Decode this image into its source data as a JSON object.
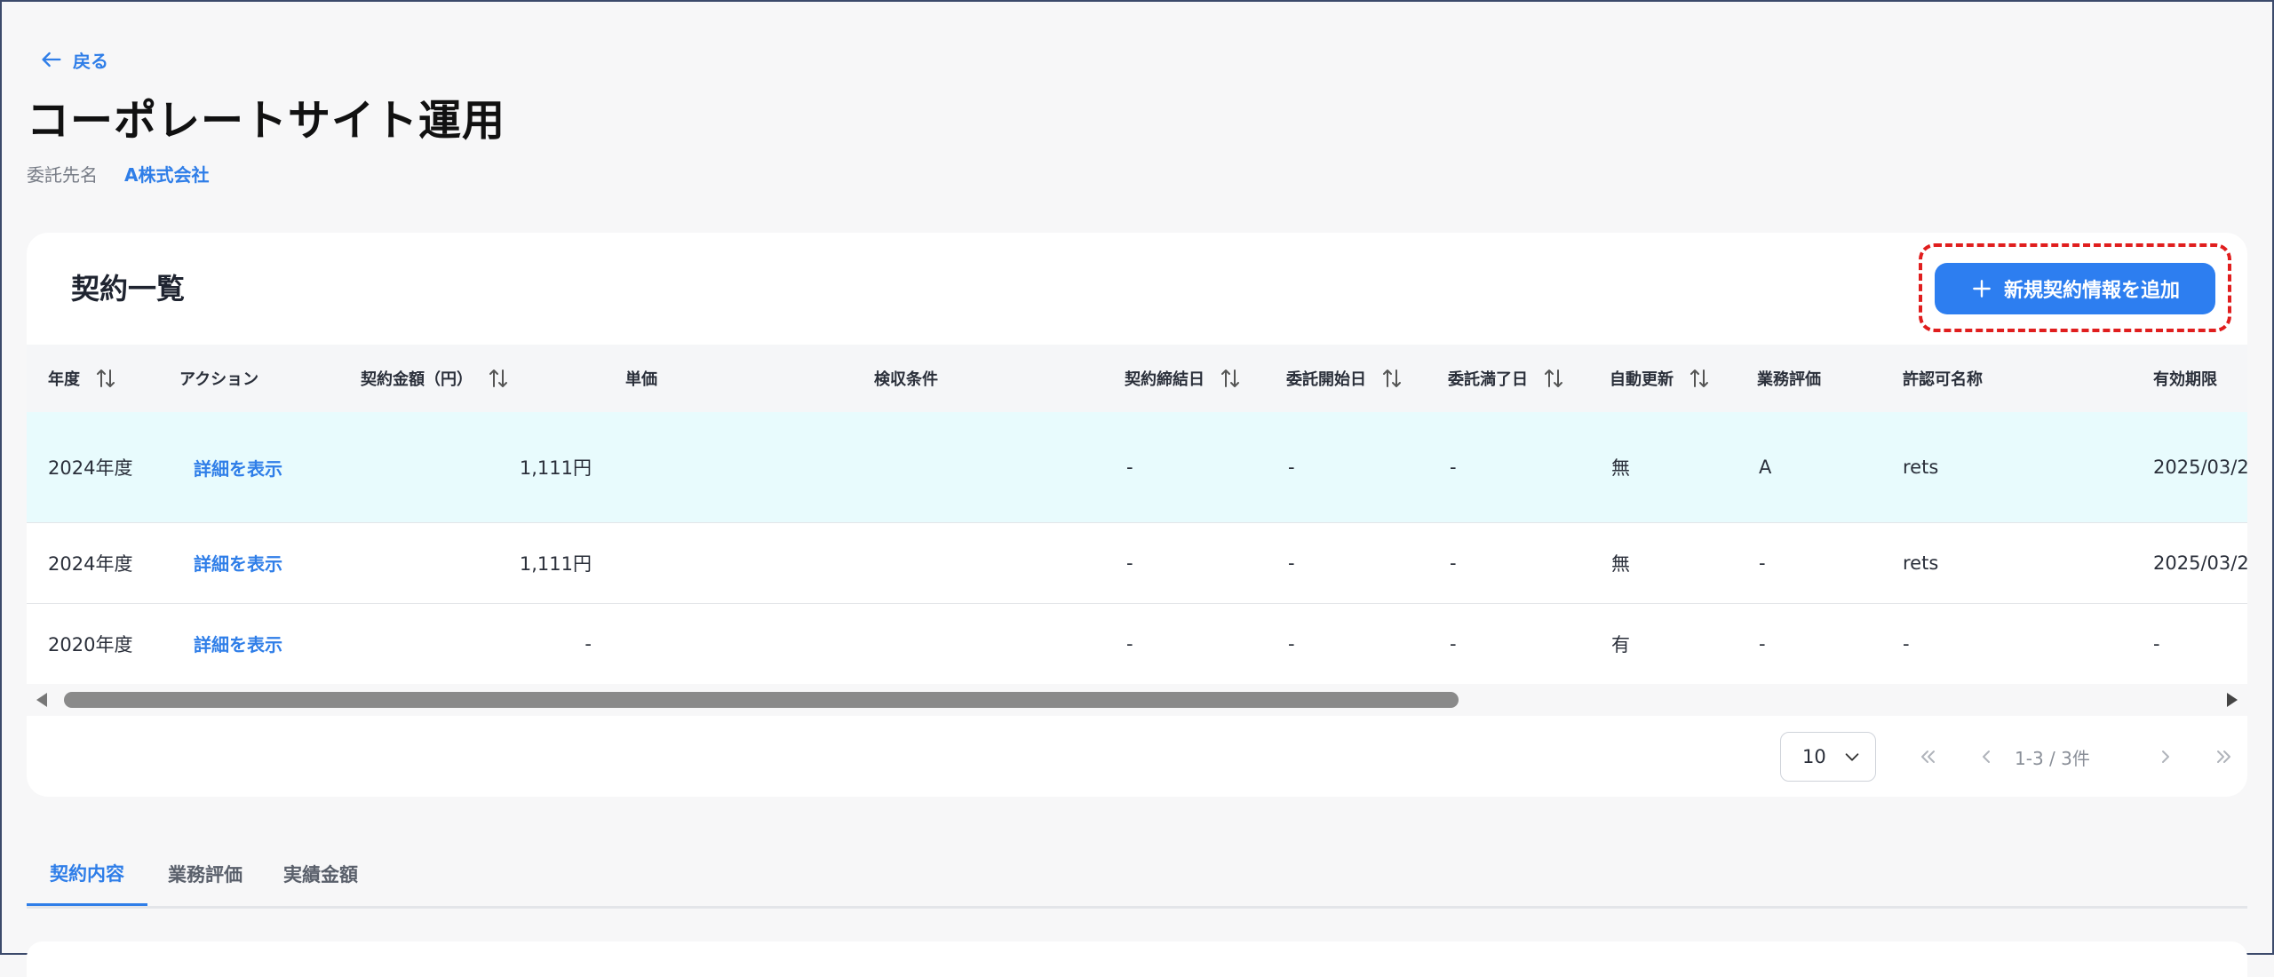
{
  "nav": {
    "back_label": "戻る"
  },
  "page": {
    "title": "コーポレートサイト運用",
    "client_label": "委託先名",
    "client_value": "A株式会社"
  },
  "contracts": {
    "title": "契約一覧",
    "add_button_label": "新規契約情報を追加",
    "columns": [
      "年度",
      "アクション",
      "契約金額（円）",
      "単価",
      "検収条件",
      "契約締結日",
      "委託開始日",
      "委託満了日",
      "自動更新",
      "業務評価",
      "許認可名称",
      "有効期限"
    ],
    "rows": [
      {
        "year": "2024年度",
        "action": "詳細を表示",
        "amount": "1,111円",
        "unit_price": "",
        "acceptance": "",
        "signed": "-",
        "start": "-",
        "end": "-",
        "auto_renew": "無",
        "evaluation": "A",
        "license": "rets",
        "expiry": "2025/03/2"
      },
      {
        "year": "2024年度",
        "action": "詳細を表示",
        "amount": "1,111円",
        "unit_price": "",
        "acceptance": "",
        "signed": "-",
        "start": "-",
        "end": "-",
        "auto_renew": "無",
        "evaluation": "-",
        "license": "rets",
        "expiry": "2025/03/2"
      },
      {
        "year": "2020年度",
        "action": "詳細を表示",
        "amount": "-",
        "unit_price": "",
        "acceptance": "",
        "signed": "-",
        "start": "-",
        "end": "-",
        "auto_renew": "有",
        "evaluation": "-",
        "license": "-",
        "expiry": "-"
      }
    ],
    "selected_row": 0
  },
  "pagination": {
    "page_size": "10",
    "range_text": "1-3 / 3件"
  },
  "tabs": [
    "契約内容",
    "業務評価",
    "実績金額"
  ],
  "active_tab": 0,
  "colors": {
    "accent": "#2d7ef0",
    "highlight_border": "#e01e1e",
    "selected_row_bg": "#e8fbfd"
  }
}
